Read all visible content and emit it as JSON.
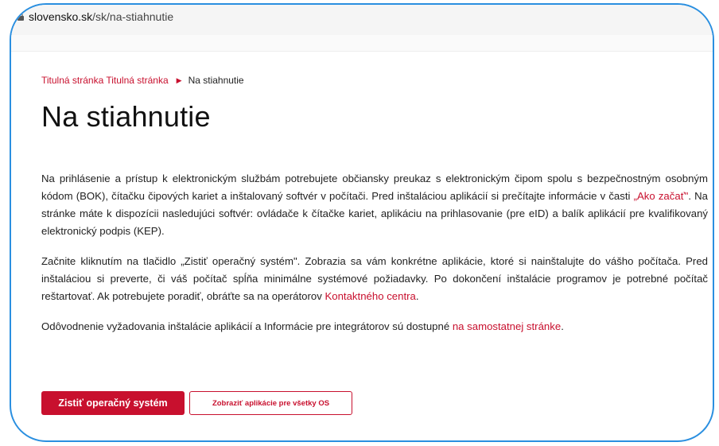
{
  "browser": {
    "url_host": "slovensko.sk",
    "url_path": "/sk/na-stiahnutie"
  },
  "breadcrumb": {
    "home_label": "Titulná stránka Titulná stránka",
    "current_label": "Na stiahnutie"
  },
  "page": {
    "title": "Na stiahnutie",
    "p1_part1": "Na prihlásenie a prístup k elektronickým službám potrebujete občiansky preukaz s elektronickým čipom spolu s bezpečnostným osobným kódom (BOK), čítačku čipových kariet a inštalovaný softvér v počítači. Pred inštaláciou aplikácií si prečítajte informácie v časti ",
    "p1_link": "„Ako začať\"",
    "p1_part2": ". Na stránke máte k dispozícii nasledujúci softvér: ovládače k čítačke kariet, aplikáciu na prihlasovanie (pre eID) a balík aplikácií pre kvalifikovaný elektronický podpis (KEP).",
    "p2_part1": "Začnite kliknutím na tlačidlo „Zistiť operačný systém\". Zobrazia sa vám konkrétne aplikácie, ktoré si nainštalujte do vášho počítača. Pred inštaláciou si preverte, či váš počítač spĺňa minimálne systémové požiadavky. Po dokončení inštalácie programov je potrebné počítač reštartovať. Ak potrebujete poradiť, obráťte sa na operátorov ",
    "p2_link": "Kontaktného centra",
    "p2_part2": ".",
    "p3_part1": "Odôvodnenie vyžadovania inštalácie aplikácií a Informácie pre integrátorov sú dostupné ",
    "p3_link": "na samostatnej stránke",
    "p3_part2": "."
  },
  "buttons": {
    "detect_os": "Zistiť operačný systém",
    "show_all_os": "Zobraziť aplikácie pre všetky OS"
  },
  "colors": {
    "accent": "#c8102e",
    "frame": "#2a8fe0"
  }
}
